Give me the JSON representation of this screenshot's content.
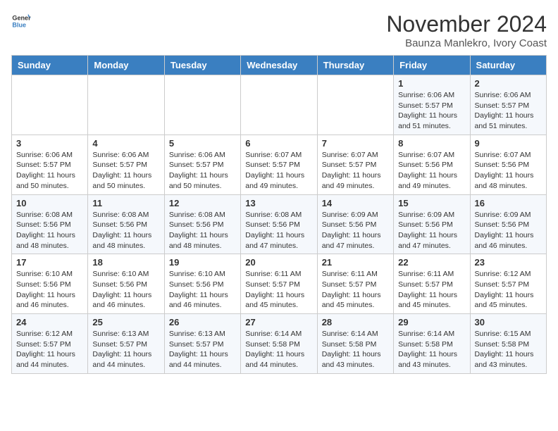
{
  "header": {
    "logo_line1": "General",
    "logo_line2": "Blue",
    "month": "November 2024",
    "location": "Baunza Manlekro, Ivory Coast"
  },
  "days_of_week": [
    "Sunday",
    "Monday",
    "Tuesday",
    "Wednesday",
    "Thursday",
    "Friday",
    "Saturday"
  ],
  "weeks": [
    [
      {
        "day": "",
        "info": ""
      },
      {
        "day": "",
        "info": ""
      },
      {
        "day": "",
        "info": ""
      },
      {
        "day": "",
        "info": ""
      },
      {
        "day": "",
        "info": ""
      },
      {
        "day": "1",
        "info": "Sunrise: 6:06 AM\nSunset: 5:57 PM\nDaylight: 11 hours\nand 51 minutes."
      },
      {
        "day": "2",
        "info": "Sunrise: 6:06 AM\nSunset: 5:57 PM\nDaylight: 11 hours\nand 51 minutes."
      }
    ],
    [
      {
        "day": "3",
        "info": "Sunrise: 6:06 AM\nSunset: 5:57 PM\nDaylight: 11 hours\nand 50 minutes."
      },
      {
        "day": "4",
        "info": "Sunrise: 6:06 AM\nSunset: 5:57 PM\nDaylight: 11 hours\nand 50 minutes."
      },
      {
        "day": "5",
        "info": "Sunrise: 6:06 AM\nSunset: 5:57 PM\nDaylight: 11 hours\nand 50 minutes."
      },
      {
        "day": "6",
        "info": "Sunrise: 6:07 AM\nSunset: 5:57 PM\nDaylight: 11 hours\nand 49 minutes."
      },
      {
        "day": "7",
        "info": "Sunrise: 6:07 AM\nSunset: 5:57 PM\nDaylight: 11 hours\nand 49 minutes."
      },
      {
        "day": "8",
        "info": "Sunrise: 6:07 AM\nSunset: 5:56 PM\nDaylight: 11 hours\nand 49 minutes."
      },
      {
        "day": "9",
        "info": "Sunrise: 6:07 AM\nSunset: 5:56 PM\nDaylight: 11 hours\nand 48 minutes."
      }
    ],
    [
      {
        "day": "10",
        "info": "Sunrise: 6:08 AM\nSunset: 5:56 PM\nDaylight: 11 hours\nand 48 minutes."
      },
      {
        "day": "11",
        "info": "Sunrise: 6:08 AM\nSunset: 5:56 PM\nDaylight: 11 hours\nand 48 minutes."
      },
      {
        "day": "12",
        "info": "Sunrise: 6:08 AM\nSunset: 5:56 PM\nDaylight: 11 hours\nand 48 minutes."
      },
      {
        "day": "13",
        "info": "Sunrise: 6:08 AM\nSunset: 5:56 PM\nDaylight: 11 hours\nand 47 minutes."
      },
      {
        "day": "14",
        "info": "Sunrise: 6:09 AM\nSunset: 5:56 PM\nDaylight: 11 hours\nand 47 minutes."
      },
      {
        "day": "15",
        "info": "Sunrise: 6:09 AM\nSunset: 5:56 PM\nDaylight: 11 hours\nand 47 minutes."
      },
      {
        "day": "16",
        "info": "Sunrise: 6:09 AM\nSunset: 5:56 PM\nDaylight: 11 hours\nand 46 minutes."
      }
    ],
    [
      {
        "day": "17",
        "info": "Sunrise: 6:10 AM\nSunset: 5:56 PM\nDaylight: 11 hours\nand 46 minutes."
      },
      {
        "day": "18",
        "info": "Sunrise: 6:10 AM\nSunset: 5:56 PM\nDaylight: 11 hours\nand 46 minutes."
      },
      {
        "day": "19",
        "info": "Sunrise: 6:10 AM\nSunset: 5:56 PM\nDaylight: 11 hours\nand 46 minutes."
      },
      {
        "day": "20",
        "info": "Sunrise: 6:11 AM\nSunset: 5:57 PM\nDaylight: 11 hours\nand 45 minutes."
      },
      {
        "day": "21",
        "info": "Sunrise: 6:11 AM\nSunset: 5:57 PM\nDaylight: 11 hours\nand 45 minutes."
      },
      {
        "day": "22",
        "info": "Sunrise: 6:11 AM\nSunset: 5:57 PM\nDaylight: 11 hours\nand 45 minutes."
      },
      {
        "day": "23",
        "info": "Sunrise: 6:12 AM\nSunset: 5:57 PM\nDaylight: 11 hours\nand 45 minutes."
      }
    ],
    [
      {
        "day": "24",
        "info": "Sunrise: 6:12 AM\nSunset: 5:57 PM\nDaylight: 11 hours\nand 44 minutes."
      },
      {
        "day": "25",
        "info": "Sunrise: 6:13 AM\nSunset: 5:57 PM\nDaylight: 11 hours\nand 44 minutes."
      },
      {
        "day": "26",
        "info": "Sunrise: 6:13 AM\nSunset: 5:57 PM\nDaylight: 11 hours\nand 44 minutes."
      },
      {
        "day": "27",
        "info": "Sunrise: 6:14 AM\nSunset: 5:58 PM\nDaylight: 11 hours\nand 44 minutes."
      },
      {
        "day": "28",
        "info": "Sunrise: 6:14 AM\nSunset: 5:58 PM\nDaylight: 11 hours\nand 43 minutes."
      },
      {
        "day": "29",
        "info": "Sunrise: 6:14 AM\nSunset: 5:58 PM\nDaylight: 11 hours\nand 43 minutes."
      },
      {
        "day": "30",
        "info": "Sunrise: 6:15 AM\nSunset: 5:58 PM\nDaylight: 11 hours\nand 43 minutes."
      }
    ]
  ]
}
